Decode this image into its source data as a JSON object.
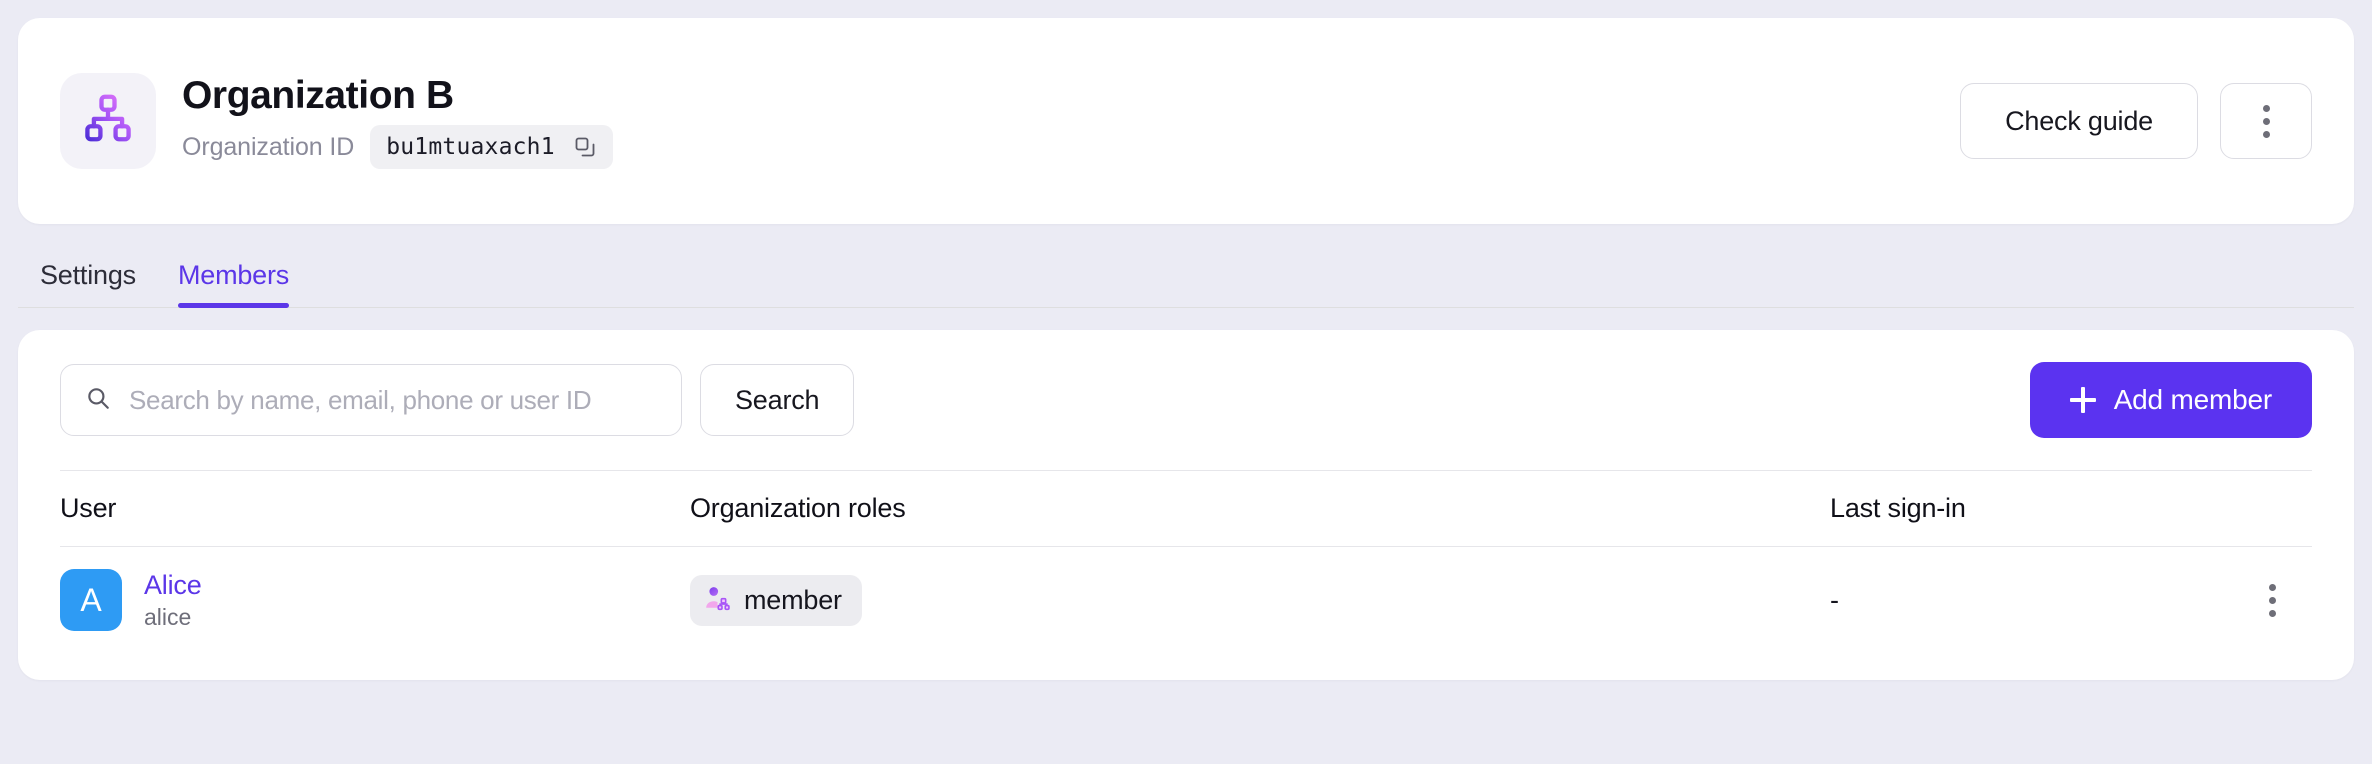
{
  "org": {
    "name": "Organization B",
    "id_label": "Organization ID",
    "id_value": "bu1mtuaxach1",
    "avatar_icon": "org-chart-icon",
    "copy_icon": "copy-icon"
  },
  "header_actions": {
    "check_guide_label": "Check guide",
    "more_icon": "more-vertical-icon"
  },
  "tabs": [
    {
      "label": "Settings",
      "active": false
    },
    {
      "label": "Members",
      "active": true
    }
  ],
  "toolbar": {
    "search_placeholder": "Search by name, email, phone or user ID",
    "search_value": "",
    "search_icon": "search-icon",
    "search_button_label": "Search",
    "add_member_label": "Add member",
    "add_member_icon": "plus-icon"
  },
  "table": {
    "columns": [
      "User",
      "Organization roles",
      "Last sign-in",
      ""
    ],
    "rows": [
      {
        "avatar_initial": "A",
        "avatar_color": "#2e9bf4",
        "name": "Alice",
        "username": "alice",
        "roles": [
          {
            "label": "member",
            "icon": "org-member-icon"
          }
        ],
        "last_sign_in": "-",
        "menu_icon": "more-vertical-icon"
      }
    ]
  },
  "colors": {
    "page_background": "#ebebf4",
    "card_background": "#ffffff",
    "accent": "#5b36e8",
    "primary_button": "#5b33f0",
    "link": "#5b36e8",
    "muted_text": "#8a8a99"
  }
}
